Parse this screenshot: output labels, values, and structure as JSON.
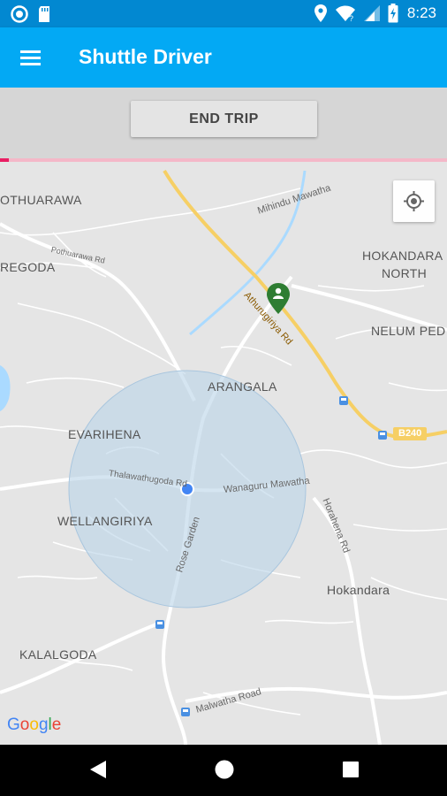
{
  "status_bar": {
    "time": "8:23",
    "icons_left": [
      "sync-circle-icon",
      "sd-card-icon"
    ],
    "icons_right": [
      "location-pin-icon",
      "wifi-icon",
      "signal-icon",
      "battery-charging-icon"
    ]
  },
  "app_bar": {
    "title": "Shuttle Driver",
    "menu_icon": "hamburger-menu-icon"
  },
  "actions": {
    "end_trip_label": "END TRIP",
    "progress": 0.02
  },
  "map": {
    "area_labels": [
      "OTHUARAWA",
      "REGODA",
      "HOKANDARA",
      "NORTH",
      "NELUM PED",
      "ARANGALA",
      "EVARIHENA",
      "WELLANGIRIYA",
      "Hokandara",
      "KALALGODA"
    ],
    "road_labels": [
      "Mihindu Mawatha",
      "Pothuarawa Rd",
      "Athurugiriya Rd",
      "B240",
      "Thalawathugoda Rd",
      "Wanaguru Mawatha",
      "Rose Garden",
      "Horahena Rd",
      "Malwatha Road"
    ],
    "my_location_icon": "my-location-crosshair-icon",
    "logo_text": "Google",
    "colors": {
      "map_background": "#e5e5e5",
      "radius_fill": "#b9d3e8",
      "current_location": "#4285f4",
      "destination_marker": "#2e7d32",
      "highway": "#f6cf65"
    }
  },
  "nav_bar": {
    "back_icon": "back-triangle-icon",
    "home_icon": "home-circle-icon",
    "recents_icon": "recents-square-icon"
  }
}
